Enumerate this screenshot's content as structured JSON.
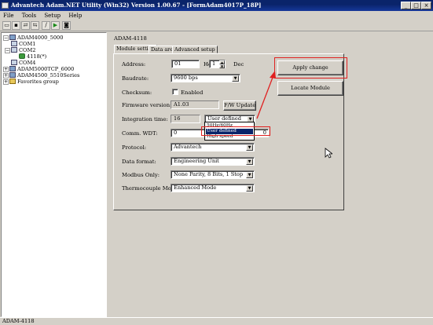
{
  "window": {
    "title": "Advantech Adam.NET Utility (Win32) Version 1.00.67 - [FormAdam4017P_18P]",
    "min": "_",
    "max": "□",
    "close": "×"
  },
  "menu": [
    "File",
    "Tools",
    "Setup",
    "Help"
  ],
  "toolbar_icons": [
    "open-icon",
    "save-icon",
    "connect-icon",
    "disconnect-icon",
    "wand-icon",
    "run-icon",
    "camera-icon"
  ],
  "tree": {
    "root": "ADAM4000_5000",
    "com1": "COM1",
    "com2": "COM2",
    "module": "4118(*)",
    "com4": "COM4",
    "tcp": "ADAM5000TCP_6000",
    "series": "ADAM4500_5510Series",
    "fav": "Favorites group"
  },
  "panel": {
    "title": "ADAM-4118",
    "tabs": [
      "Module setting",
      "Data area",
      "Advanced setup"
    ]
  },
  "form": {
    "address_label": "Address:",
    "address_hex": "01",
    "hex_label": "Hex",
    "address_dec": "1",
    "dec_label": "Dec",
    "baudrate_label": "Baudrate:",
    "baudrate_value": "9600 bps",
    "checksum_label": "Checksum:",
    "checksum_enabled": "Enabled",
    "firmware_label": "Firmware version:",
    "firmware_value": "A1.03",
    "fw_update": "F/W Update",
    "integration_label": "Integration time:",
    "integration_value": "16",
    "integration_mode": "User defined",
    "integration_options": [
      "50Hz/60Hz",
      "User defined",
      "High speed"
    ],
    "integration_selected": 1,
    "wdt_label": "Comm. WDT:",
    "wdt_value": "0",
    "wdt_suffix": "0",
    "protocol_label": "Protocol:",
    "protocol_value": "Advantech",
    "format_label": "Data format:",
    "format_value": "Engineering Unit",
    "modbus_label": "Modbus Only:",
    "modbus_value": "None Parity, 8 Bits, 1 Stop",
    "tc_label": "Thermocouple Mode:",
    "tc_value": "Enhanced Mode",
    "apply": "Apply change",
    "locate": "Locate Module"
  },
  "status": {
    "text": "ADAM-4118"
  },
  "colors": {
    "annotation": "#e02020",
    "titlebar": "#0a246a",
    "selection": "#0a246a"
  }
}
